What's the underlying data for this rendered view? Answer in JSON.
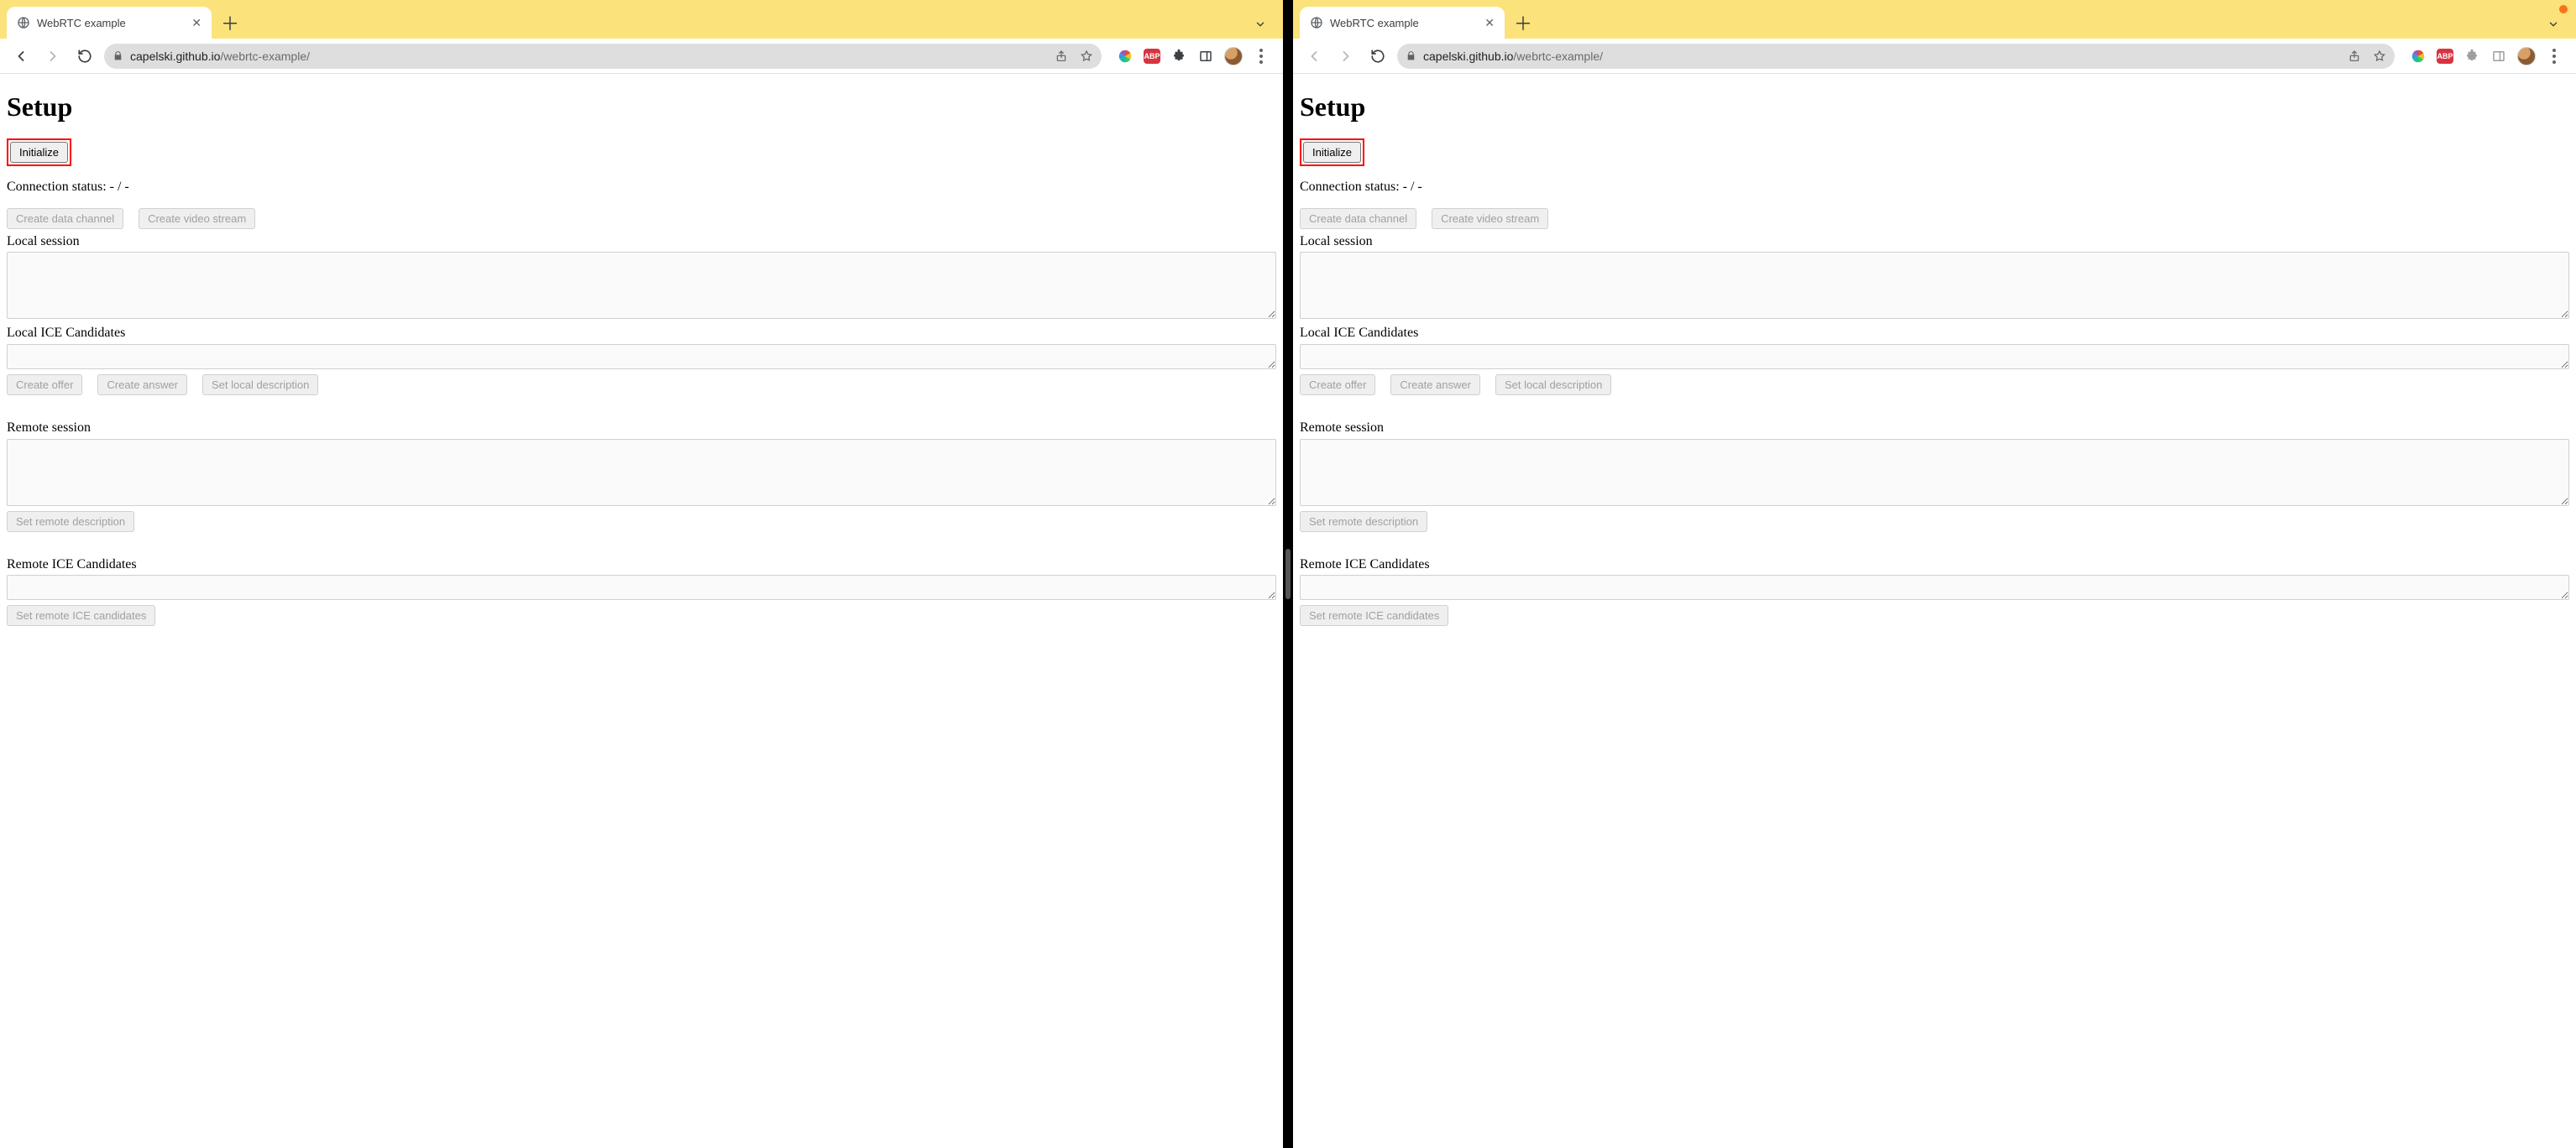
{
  "browser": {
    "tab_title": "WebRTC example",
    "url_host": "capelski.github.io",
    "url_path": "/webrtc-example/",
    "ext_labels": {
      "abp": "ABP"
    }
  },
  "page": {
    "title": "Setup",
    "initialize_label": "Initialize",
    "status_label": "Connection status: ",
    "status_value": "- / -",
    "buttons": {
      "create_data_channel": "Create data channel",
      "create_video_stream": "Create video stream",
      "create_offer": "Create offer",
      "create_answer": "Create answer",
      "set_local_description": "Set local description",
      "set_remote_description": "Set remote description",
      "set_remote_ice": "Set remote ICE candidates"
    },
    "labels": {
      "local_session": "Local session",
      "local_ice": "Local ICE Candidates",
      "remote_session": "Remote session",
      "remote_ice": "Remote ICE Candidates"
    },
    "fields": {
      "local_session": "",
      "local_ice": "",
      "remote_session": "",
      "remote_ice": ""
    }
  },
  "left_window": {
    "nav_back_enabled": true,
    "nav_fwd_enabled": false,
    "show_window_dot": false,
    "dim_ext": false
  },
  "right_window": {
    "nav_back_enabled": false,
    "nav_fwd_enabled": false,
    "show_window_dot": true,
    "dim_ext": true
  }
}
